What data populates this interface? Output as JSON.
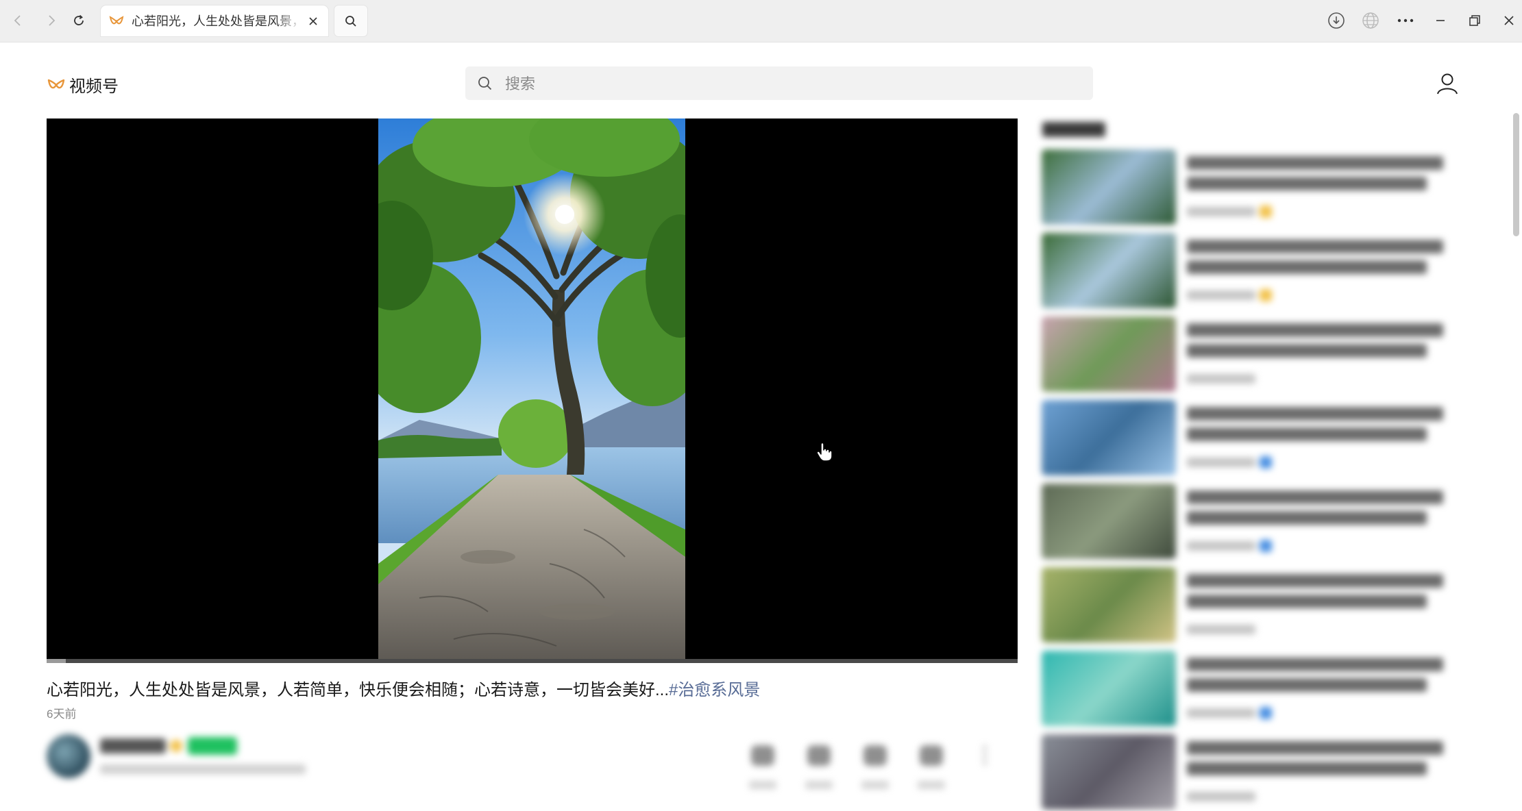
{
  "browser": {
    "tab_title": "心若阳光，人生处处皆是风景，人若简单，快乐便会相随；心若诗意，一切皆会美好...#治愈系风景",
    "colors": {
      "chrome_bg": "#efefef",
      "brand": "#e8963a"
    }
  },
  "header": {
    "logo_text": "视频号",
    "search_placeholder": "搜索"
  },
  "player": {
    "progress": 0.02,
    "icons": {
      "cursor": "hand-pointer-icon"
    }
  },
  "video": {
    "description": "心若阳光，人生处处皆是风景，人若简单，快乐便会相随；心若诗意，一切皆会美好...",
    "hashtag": "#治愈系风景",
    "posted_time": "6天前",
    "hashtag_color": "#576b95"
  },
  "sidebar": {
    "items": [
      {
        "thumb_colors": [
          "#3d6e3a",
          "#9bbbd4",
          "#2e5a34"
        ],
        "tag_color": "#f2c24b"
      },
      {
        "thumb_colors": [
          "#3a6b36",
          "#a9c7dc",
          "#2c5530"
        ],
        "tag_color": "#f2c24b"
      },
      {
        "thumb_colors": [
          "#c9a3b0",
          "#6f9a58",
          "#b07a92"
        ],
        "tag_color": ""
      },
      {
        "thumb_colors": [
          "#6fa2d4",
          "#3d6f9b",
          "#9cc4e8"
        ],
        "tag_color": "#4a90e2"
      },
      {
        "thumb_colors": [
          "#5d6a55",
          "#8b9a7e",
          "#3f4a3c"
        ],
        "tag_color": "#4a90e2"
      },
      {
        "thumb_colors": [
          "#a7b36a",
          "#6b8a4a",
          "#d2c486"
        ],
        "tag_color": ""
      },
      {
        "thumb_colors": [
          "#2fb7b0",
          "#8ad6c9",
          "#1e8f8a"
        ],
        "tag_color": "#4a90e2"
      },
      {
        "thumb_colors": [
          "#8a8f98",
          "#5d5a66",
          "#a7a4ac"
        ],
        "tag_color": ""
      }
    ]
  }
}
